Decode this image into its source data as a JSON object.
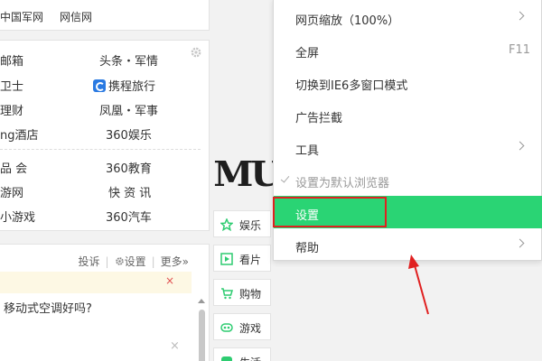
{
  "top_links": [
    "中国军网",
    "网信网"
  ],
  "links_panel": {
    "left_column": [
      "邮箱",
      "卫士",
      "理财",
      "ng酒店",
      "品 会",
      "游网",
      "小游戏"
    ],
    "right_column": [
      "头条・军情",
      "携程旅行",
      "凤凰・军事",
      "360娱乐",
      "360教育",
      "快 资 讯",
      "360汽车"
    ]
  },
  "news_panel": {
    "toolbar": {
      "complain": "投诉",
      "settings": "设置",
      "more": "更多»"
    },
    "tip_close": "×",
    "question": "移动式空调好吗?",
    "close": "×"
  },
  "logo_text": "MU",
  "categories": [
    {
      "label": "娱乐",
      "icon": "star-icon"
    },
    {
      "label": "看片",
      "icon": "play-icon"
    },
    {
      "label": "购物",
      "icon": "cart-icon"
    },
    {
      "label": "游戏",
      "icon": "gamepad-icon"
    },
    {
      "label": "生活",
      "icon": "life-icon"
    }
  ],
  "menu": {
    "items": [
      {
        "label": "网页缩放（100%）",
        "submenu": true
      },
      {
        "label": "全屏",
        "shortcut": "F11"
      },
      {
        "label": "切换到IE6多窗口模式"
      },
      {
        "label": "广告拦截"
      },
      {
        "label": "工具",
        "submenu": true
      },
      {
        "label": "设置为默认浏览器",
        "checked": true,
        "disabled": true
      },
      {
        "label": "设置",
        "active": true
      },
      {
        "label": "帮助",
        "submenu": true
      }
    ]
  },
  "colors": {
    "menu_active": "#2ad474",
    "highlight_box": "#e02020",
    "arrow": "#e02020",
    "ctrip_blue": "#2a7ae2",
    "category_green": "#2ecc71"
  }
}
